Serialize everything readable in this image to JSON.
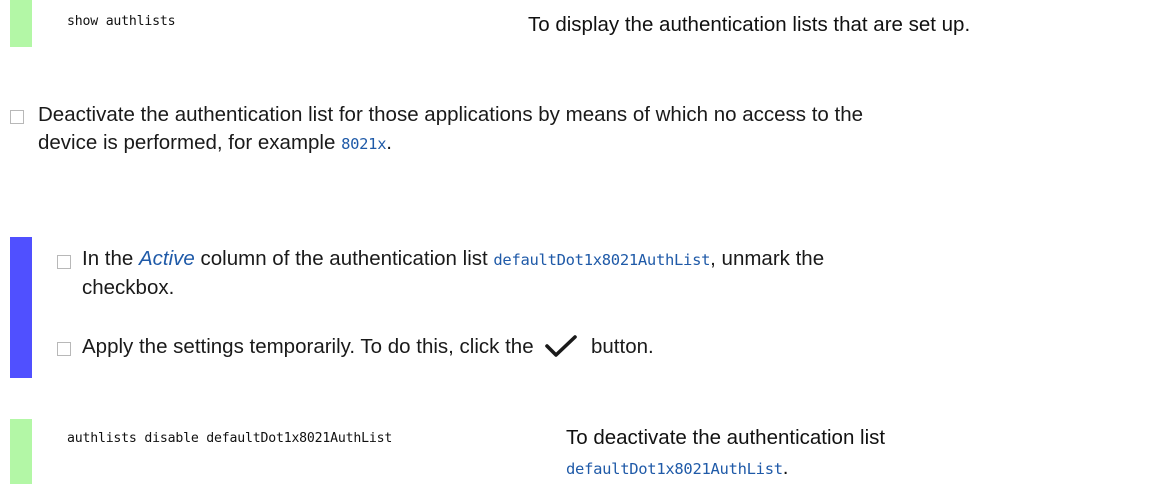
{
  "cli_1": {
    "command": "show authlists",
    "description": "To display the authentication lists that are set up."
  },
  "step_main": {
    "line1": "Deactivate the authentication list for those applications by means of which no access to the",
    "line2_prefix": "device is performed, for example ",
    "line2_code": "8021x",
    "line2_suffix": "."
  },
  "gui_steps": {
    "step1_prefix": "In the ",
    "step1_italic": "Active",
    "step1_middle": " column of the authentication list ",
    "step1_code": "defaultDot1x8021AuthList",
    "step1_suffix": ", unmark the",
    "step1_line2": "checkbox.",
    "step2_prefix": "Apply the settings temporarily. To do this, click the",
    "step2_icon": "checkmark-icon",
    "step2_suffix": "button."
  },
  "cli_2": {
    "command": "authlists disable defaultDot1x8021AuthList",
    "description_line1": "To deactivate the authentication list",
    "description_code": "defaultDot1x8021AuthList",
    "description_suffix": "."
  },
  "colors": {
    "cli_bar": "#b3f7a6",
    "gui_bar": "#5050ff",
    "code": "#1f5aa8"
  }
}
